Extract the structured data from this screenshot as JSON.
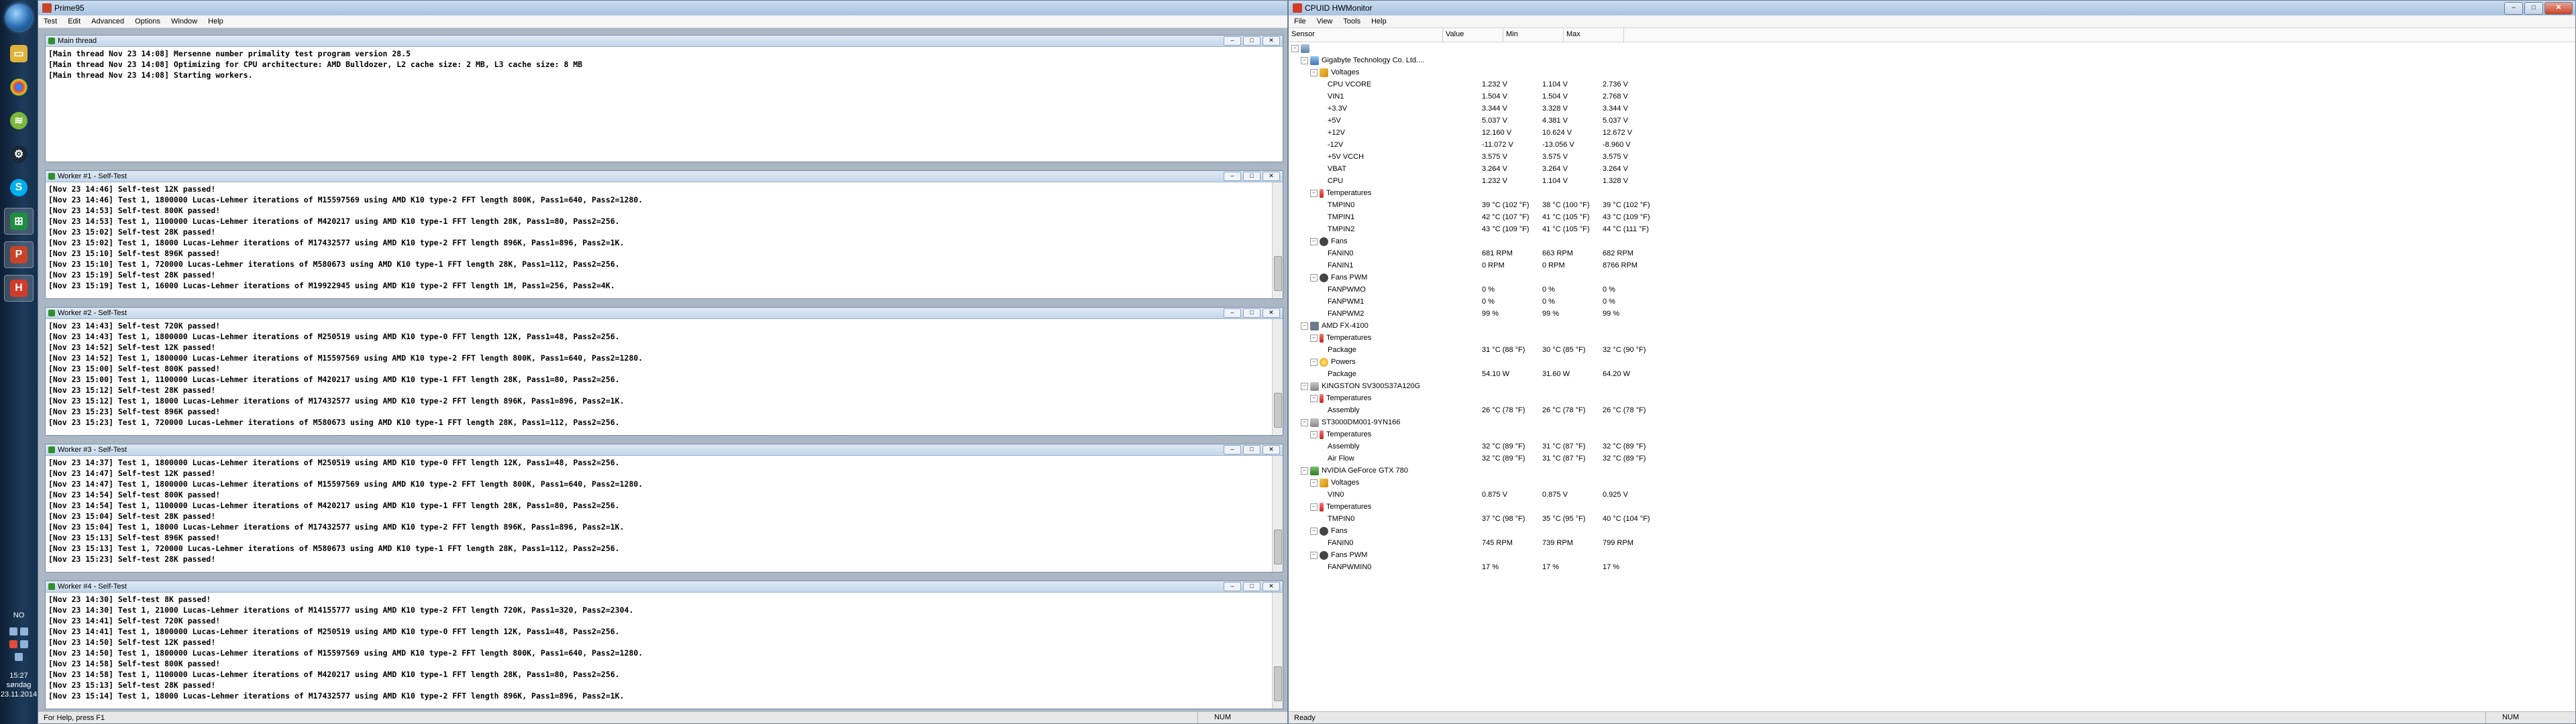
{
  "taskbar": {
    "clock_time": "15:27",
    "clock_day": "søndag",
    "clock_date": "23.11.2014",
    "language": "NO"
  },
  "prime95": {
    "title": "Prime95",
    "menu": [
      "Test",
      "Edit",
      "Advanced",
      "Options",
      "Window",
      "Help"
    ],
    "status_text": "For Help, press F1",
    "status_num": "NUM",
    "main_thread": {
      "title": "Main thread",
      "lines": [
        "[Main thread Nov 23 14:08] Mersenne number primality test program version 28.5",
        "[Main thread Nov 23 14:08] Optimizing for CPU architecture: AMD Bulldozer, L2 cache size: 2 MB, L3 cache size: 8 MB",
        "[Main thread Nov 23 14:08] Starting workers."
      ]
    },
    "workers": [
      {
        "title": "Worker #1 - Self-Test",
        "lines": [
          "[Nov 23 14:46] Self-test 12K passed!",
          "[Nov 23 14:46] Test 1, 1800000 Lucas-Lehmer iterations of M15597569 using AMD K10 type-2 FFT length 800K, Pass1=640, Pass2=1280.",
          "[Nov 23 14:53] Self-test 800K passed!",
          "[Nov 23 14:53] Test 1, 1100000 Lucas-Lehmer iterations of M420217 using AMD K10 type-1 FFT length 28K, Pass1=80, Pass2=256.",
          "[Nov 23 15:02] Self-test 28K passed!",
          "[Nov 23 15:02] Test 1, 18000 Lucas-Lehmer iterations of M17432577 using AMD K10 type-2 FFT length 896K, Pass1=896, Pass2=1K.",
          "[Nov 23 15:10] Self-test 896K passed!",
          "[Nov 23 15:10] Test 1, 720000 Lucas-Lehmer iterations of M580673 using AMD K10 type-1 FFT length 28K, Pass1=112, Pass2=256.",
          "[Nov 23 15:19] Self-test 28K passed!",
          "[Nov 23 15:19] Test 1, 16000 Lucas-Lehmer iterations of M19922945 using AMD K10 type-2 FFT length 1M, Pass1=256, Pass2=4K."
        ]
      },
      {
        "title": "Worker #2 - Self-Test",
        "lines": [
          "[Nov 23 14:43] Self-test 720K passed!",
          "[Nov 23 14:43] Test 1, 1800000 Lucas-Lehmer iterations of M250519 using AMD K10 type-0 FFT length 12K, Pass1=48, Pass2=256.",
          "[Nov 23 14:52] Self-test 12K passed!",
          "[Nov 23 14:52] Test 1, 1800000 Lucas-Lehmer iterations of M15597569 using AMD K10 type-2 FFT length 800K, Pass1=640, Pass2=1280.",
          "[Nov 23 15:00] Self-test 800K passed!",
          "[Nov 23 15:00] Test 1, 1100000 Lucas-Lehmer iterations of M420217 using AMD K10 type-1 FFT length 28K, Pass1=80, Pass2=256.",
          "[Nov 23 15:12] Self-test 28K passed!",
          "[Nov 23 15:12] Test 1, 18000 Lucas-Lehmer iterations of M17432577 using AMD K10 type-2 FFT length 896K, Pass1=896, Pass2=1K.",
          "[Nov 23 15:23] Self-test 896K passed!",
          "[Nov 23 15:23] Test 1, 720000 Lucas-Lehmer iterations of M580673 using AMD K10 type-1 FFT length 28K, Pass1=112, Pass2=256."
        ]
      },
      {
        "title": "Worker #3 - Self-Test",
        "lines": [
          "[Nov 23 14:37] Test 1, 1800000 Lucas-Lehmer iterations of M250519 using AMD K10 type-0 FFT length 12K, Pass1=48, Pass2=256.",
          "[Nov 23 14:47] Self-test 12K passed!",
          "[Nov 23 14:47] Test 1, 1800000 Lucas-Lehmer iterations of M15597569 using AMD K10 type-2 FFT length 800K, Pass1=640, Pass2=1280.",
          "[Nov 23 14:54] Self-test 800K passed!",
          "[Nov 23 14:54] Test 1, 1100000 Lucas-Lehmer iterations of M420217 using AMD K10 type-1 FFT length 28K, Pass1=80, Pass2=256.",
          "[Nov 23 15:04] Self-test 28K passed!",
          "[Nov 23 15:04] Test 1, 18000 Lucas-Lehmer iterations of M17432577 using AMD K10 type-2 FFT length 896K, Pass1=896, Pass2=1K.",
          "[Nov 23 15:13] Self-test 896K passed!",
          "[Nov 23 15:13] Test 1, 720000 Lucas-Lehmer iterations of M580673 using AMD K10 type-1 FFT length 28K, Pass1=112, Pass2=256.",
          "[Nov 23 15:23] Self-test 28K passed!"
        ]
      },
      {
        "title": "Worker #4 - Self-Test",
        "lines": [
          "[Nov 23 14:30] Self-test 8K passed!",
          "[Nov 23 14:30] Test 1, 21000 Lucas-Lehmer iterations of M14155777 using AMD K10 type-2 FFT length 720K, Pass1=320, Pass2=2304.",
          "[Nov 23 14:41] Self-test 720K passed!",
          "[Nov 23 14:41] Test 1, 1800000 Lucas-Lehmer iterations of M250519 using AMD K10 type-0 FFT length 12K, Pass1=48, Pass2=256.",
          "[Nov 23 14:50] Self-test 12K passed!",
          "[Nov 23 14:50] Test 1, 1800000 Lucas-Lehmer iterations of M15597569 using AMD K10 type-2 FFT length 800K, Pass1=640, Pass2=1280.",
          "[Nov 23 14:58] Self-test 800K passed!",
          "[Nov 23 14:58] Test 1, 1100000 Lucas-Lehmer iterations of M420217 using AMD K10 type-1 FFT length 28K, Pass1=80, Pass2=256.",
          "[Nov 23 15:13] Self-test 28K passed!",
          "[Nov 23 15:14] Test 1, 18000 Lucas-Lehmer iterations of M17432577 using AMD K10 type-2 FFT length 896K, Pass1=896, Pass2=1K."
        ]
      }
    ]
  },
  "hwmonitor": {
    "title": "CPUID HWMonitor",
    "menu": [
      "File",
      "View",
      "Tools",
      "Help"
    ],
    "columns": [
      "Sensor",
      "Value",
      "Min",
      "Max"
    ],
    "status_text": "Ready",
    "status_num": "NUM",
    "rows": [
      {
        "level": 0,
        "type": "root",
        "icon": "ic-pc",
        "label": "",
        "value": "",
        "min": "",
        "max": ""
      },
      {
        "level": 1,
        "type": "node",
        "icon": "ic-mb",
        "label": "Gigabyte Technology Co. Ltd....",
        "value": "",
        "min": "",
        "max": ""
      },
      {
        "level": 2,
        "type": "node",
        "icon": "ic-volt",
        "label": "Voltages",
        "value": "",
        "min": "",
        "max": ""
      },
      {
        "level": 3,
        "type": "leaf",
        "label": "CPU VCORE",
        "value": "1.232 V",
        "min": "1.104 V",
        "max": "2.736 V"
      },
      {
        "level": 3,
        "type": "leaf",
        "label": "VIN1",
        "value": "1.504 V",
        "min": "1.504 V",
        "max": "2.768 V"
      },
      {
        "level": 3,
        "type": "leaf",
        "label": "+3.3V",
        "value": "3.344 V",
        "min": "3.328 V",
        "max": "3.344 V"
      },
      {
        "level": 3,
        "type": "leaf",
        "label": "+5V",
        "value": "5.037 V",
        "min": "4.381 V",
        "max": "5.037 V"
      },
      {
        "level": 3,
        "type": "leaf",
        "label": "+12V",
        "value": "12.160 V",
        "min": "10.624 V",
        "max": "12.672 V"
      },
      {
        "level": 3,
        "type": "leaf",
        "label": "-12V",
        "value": "-11.072 V",
        "min": "-13.056 V",
        "max": "-8.960 V"
      },
      {
        "level": 3,
        "type": "leaf",
        "label": "+5V VCCH",
        "value": "3.575 V",
        "min": "3.575 V",
        "max": "3.575 V"
      },
      {
        "level": 3,
        "type": "leaf",
        "label": "VBAT",
        "value": "3.264 V",
        "min": "3.264 V",
        "max": "3.264 V"
      },
      {
        "level": 3,
        "type": "leaf",
        "label": "CPU",
        "value": "1.232 V",
        "min": "1.104 V",
        "max": "1.328 V"
      },
      {
        "level": 2,
        "type": "node",
        "icon": "ic-temp",
        "label": "Temperatures",
        "value": "",
        "min": "",
        "max": ""
      },
      {
        "level": 3,
        "type": "leaf",
        "label": "TMPIN0",
        "value": "39 °C  (102 °F)",
        "min": "38 °C  (100 °F)",
        "max": "39 °C  (102 °F)"
      },
      {
        "level": 3,
        "type": "leaf",
        "label": "TMPIN1",
        "value": "42 °C  (107 °F)",
        "min": "41 °C  (105 °F)",
        "max": "43 °C  (109 °F)"
      },
      {
        "level": 3,
        "type": "leaf",
        "label": "TMPIN2",
        "value": "43 °C  (109 °F)",
        "min": "41 °C  (105 °F)",
        "max": "44 °C  (111 °F)"
      },
      {
        "level": 2,
        "type": "node",
        "icon": "ic-fan",
        "label": "Fans",
        "value": "",
        "min": "",
        "max": ""
      },
      {
        "level": 3,
        "type": "leaf",
        "label": "FANIN0",
        "value": "681 RPM",
        "min": "663 RPM",
        "max": "682 RPM"
      },
      {
        "level": 3,
        "type": "leaf",
        "label": "FANIN1",
        "value": "0 RPM",
        "min": "0 RPM",
        "max": "8766 RPM"
      },
      {
        "level": 2,
        "type": "node",
        "icon": "ic-fan",
        "label": "Fans PWM",
        "value": "",
        "min": "",
        "max": ""
      },
      {
        "level": 3,
        "type": "leaf",
        "label": "FANPWMO",
        "value": "0 %",
        "min": "0 %",
        "max": "0 %"
      },
      {
        "level": 3,
        "type": "leaf",
        "label": "FANPWM1",
        "value": "0 %",
        "min": "0 %",
        "max": "0 %"
      },
      {
        "level": 3,
        "type": "leaf",
        "label": "FANPWM2",
        "value": "99 %",
        "min": "99 %",
        "max": "99 %"
      },
      {
        "level": 1,
        "type": "node",
        "icon": "ic-chip",
        "label": "AMD FX-4100",
        "value": "",
        "min": "",
        "max": ""
      },
      {
        "level": 2,
        "type": "node",
        "icon": "ic-temp",
        "label": "Temperatures",
        "value": "",
        "min": "",
        "max": ""
      },
      {
        "level": 3,
        "type": "leaf",
        "label": "Package",
        "value": "31 °C  (88 °F)",
        "min": "30 °C  (85 °F)",
        "max": "32 °C  (90 °F)"
      },
      {
        "level": 2,
        "type": "node",
        "icon": "ic-power",
        "label": "Powers",
        "value": "",
        "min": "",
        "max": ""
      },
      {
        "level": 3,
        "type": "leaf",
        "label": "Package",
        "value": "54.10 W",
        "min": "31.60 W",
        "max": "64.20 W"
      },
      {
        "level": 1,
        "type": "node",
        "icon": "ic-hdd",
        "label": "KINGSTON SV300S37A120G",
        "value": "",
        "min": "",
        "max": ""
      },
      {
        "level": 2,
        "type": "node",
        "icon": "ic-temp",
        "label": "Temperatures",
        "value": "",
        "min": "",
        "max": ""
      },
      {
        "level": 3,
        "type": "leaf",
        "label": "Assembly",
        "value": "26 °C  (78 °F)",
        "min": "26 °C  (78 °F)",
        "max": "26 °C  (78 °F)"
      },
      {
        "level": 1,
        "type": "node",
        "icon": "ic-hdd",
        "label": "ST3000DM001-9YN166",
        "value": "",
        "min": "",
        "max": ""
      },
      {
        "level": 2,
        "type": "node",
        "icon": "ic-temp",
        "label": "Temperatures",
        "value": "",
        "min": "",
        "max": ""
      },
      {
        "level": 3,
        "type": "leaf",
        "label": "Assembly",
        "value": "32 °C  (89 °F)",
        "min": "31 °C  (87 °F)",
        "max": "32 °C  (89 °F)"
      },
      {
        "level": 3,
        "type": "leaf",
        "label": "Air Flow",
        "value": "32 °C  (89 °F)",
        "min": "31 °C  (87 °F)",
        "max": "32 °C  (89 °F)"
      },
      {
        "level": 1,
        "type": "node",
        "icon": "ic-gpu",
        "label": "NVIDIA GeForce GTX 780",
        "value": "",
        "min": "",
        "max": ""
      },
      {
        "level": 2,
        "type": "node",
        "icon": "ic-volt",
        "label": "Voltages",
        "value": "",
        "min": "",
        "max": ""
      },
      {
        "level": 3,
        "type": "leaf",
        "label": "VIN0",
        "value": "0.875 V",
        "min": "0.875 V",
        "max": "0.925 V"
      },
      {
        "level": 2,
        "type": "node",
        "icon": "ic-temp",
        "label": "Temperatures",
        "value": "",
        "min": "",
        "max": ""
      },
      {
        "level": 3,
        "type": "leaf",
        "label": "TMPIN0",
        "value": "37 °C  (98 °F)",
        "min": "35 °C  (95 °F)",
        "max": "40 °C  (104 °F)"
      },
      {
        "level": 2,
        "type": "node",
        "icon": "ic-fan",
        "label": "Fans",
        "value": "",
        "min": "",
        "max": ""
      },
      {
        "level": 3,
        "type": "leaf",
        "label": "FANIN0",
        "value": "745 RPM",
        "min": "739 RPM",
        "max": "799 RPM"
      },
      {
        "level": 2,
        "type": "node",
        "icon": "ic-fan",
        "label": "Fans PWM",
        "value": "",
        "min": "",
        "max": ""
      },
      {
        "level": 3,
        "type": "leaf",
        "label": "FANPWMIN0",
        "value": "17 %",
        "min": "17 %",
        "max": "17 %"
      }
    ]
  },
  "colors": {
    "accent": "#3f77b3",
    "prime95_icon": "#c7432a",
    "hwmon_icon": "#d13b2a"
  }
}
